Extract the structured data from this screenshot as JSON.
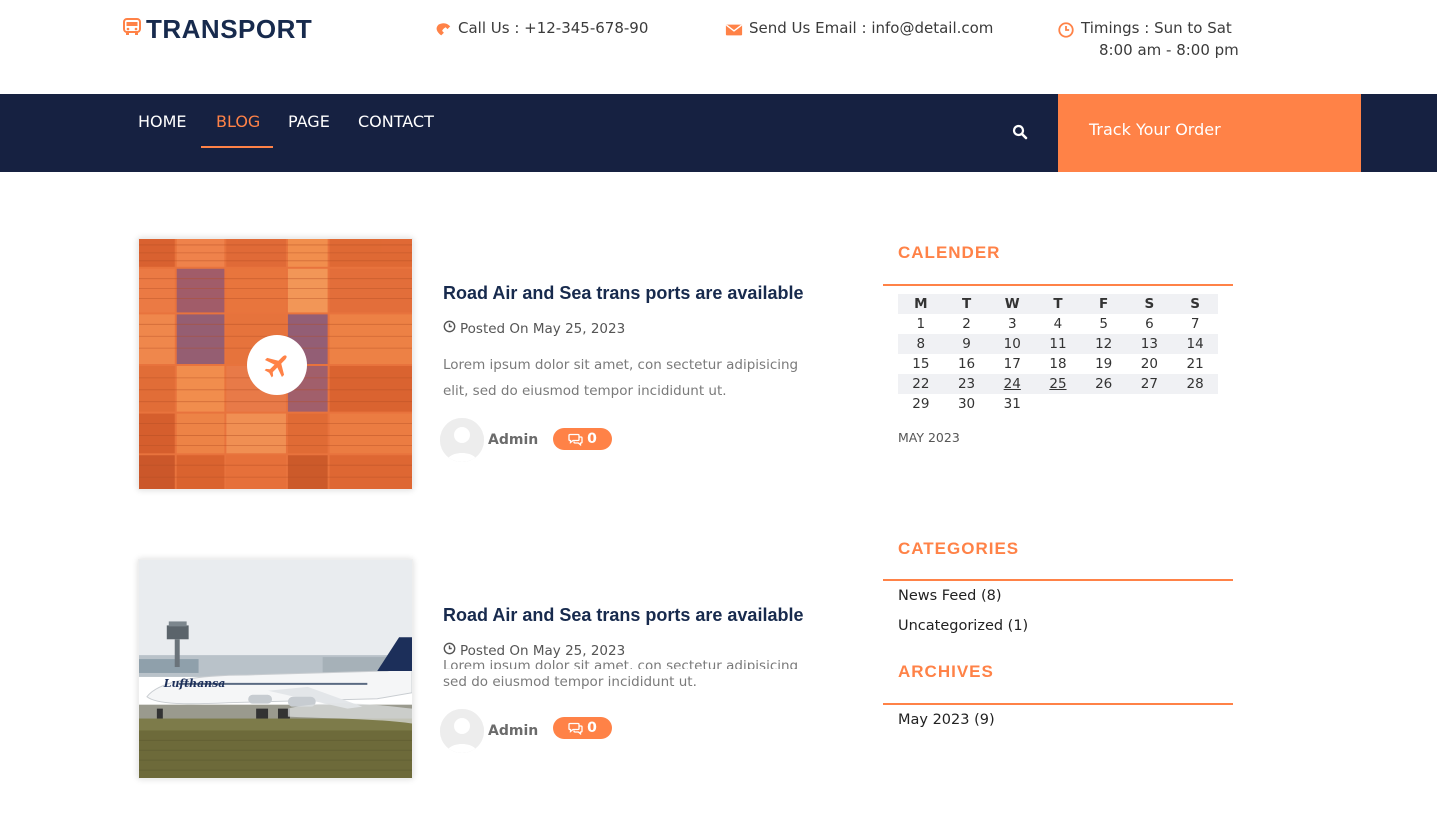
{
  "brand": {
    "name": "TRANSPORT",
    "color": "#172a4d",
    "accent": "#ff8247"
  },
  "contact": {
    "call": "Call Us : +12-345-678-90",
    "email": "Send Us Email : info@detail.com",
    "timings_line1": "Timings : Sun to Sat",
    "timings_line2": "8:00 am - 8:00 pm"
  },
  "nav": {
    "items": [
      {
        "label": "HOME",
        "active": false
      },
      {
        "label": "BLOG",
        "active": true
      },
      {
        "label": "PAGE",
        "active": false
      },
      {
        "label": "CONTACT",
        "active": false
      }
    ],
    "track_label": "Track Your Order",
    "background": "#162141"
  },
  "posts": [
    {
      "title": "Road Air and Sea trans ports are available",
      "date": "Posted On May 25, 2023",
      "excerpt": "Lorem ipsum dolor sit amet, con sectetur adipisicing elit, sed do eiusmod tempor incididunt ut.",
      "author": "Admin",
      "comments": "0",
      "image": "shipping-containers",
      "icon": "airplane-icon"
    },
    {
      "title": "Road Air and Sea trans ports are available",
      "date": "Posted On May 25, 2023",
      "excerpt_line1": "Lorem ipsum dolor sit amet, con sectetur adipisicing elit,",
      "excerpt_line2": "sed do eiusmod tempor incididunt ut.",
      "author": "Admin",
      "comments": "0",
      "image": "airplane-runway"
    }
  ],
  "sidebar": {
    "calendar_title": "CALENDER",
    "calendar_caption": "MAY 2023",
    "weekdays": [
      "M",
      "T",
      "W",
      "T",
      "F",
      "S",
      "S"
    ],
    "weeks": [
      [
        "1",
        "2",
        "3",
        "4",
        "5",
        "6",
        "7"
      ],
      [
        "8",
        "9",
        "10",
        "11",
        "12",
        "13",
        "14"
      ],
      [
        "15",
        "16",
        "17",
        "18",
        "19",
        "20",
        "21"
      ],
      [
        "22",
        "23",
        "24",
        "25",
        "26",
        "27",
        "28"
      ],
      [
        "29",
        "30",
        "31",
        "",
        "",
        "",
        ""
      ]
    ],
    "linked_days": [
      "24",
      "25"
    ],
    "categories_title": "CATEGORIES",
    "categories": [
      "News Feed (8)",
      "Uncategorized (1)"
    ],
    "archives_title": "ARCHIVES",
    "archives": [
      "May 2023 (9)"
    ]
  }
}
